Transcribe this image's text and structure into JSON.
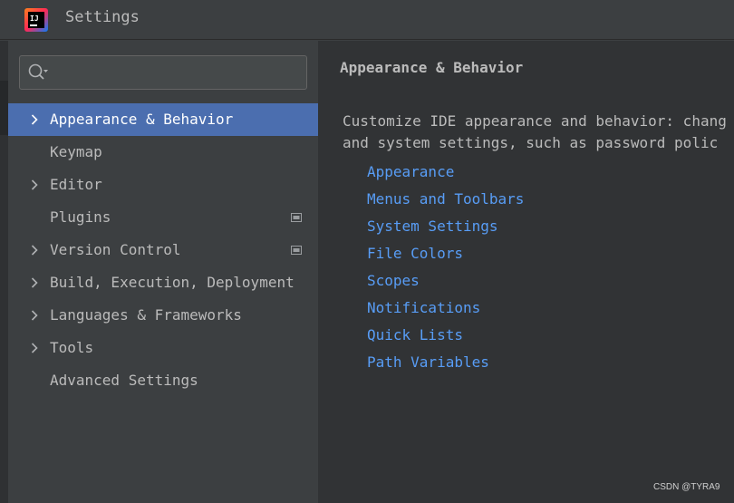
{
  "window": {
    "title": "Settings",
    "logo_text": "IJ"
  },
  "search": {
    "placeholder": "",
    "value": ""
  },
  "sidebar": {
    "items": [
      {
        "label": "Appearance & Behavior",
        "expandable": true,
        "selected": true,
        "badge": false
      },
      {
        "label": "Keymap",
        "expandable": false,
        "selected": false,
        "badge": false
      },
      {
        "label": "Editor",
        "expandable": true,
        "selected": false,
        "badge": false
      },
      {
        "label": "Plugins",
        "expandable": false,
        "selected": false,
        "badge": true
      },
      {
        "label": "Version Control",
        "expandable": true,
        "selected": false,
        "badge": true
      },
      {
        "label": "Build, Execution, Deployment",
        "expandable": true,
        "selected": false,
        "badge": false
      },
      {
        "label": "Languages & Frameworks",
        "expandable": true,
        "selected": false,
        "badge": false
      },
      {
        "label": "Tools",
        "expandable": true,
        "selected": false,
        "badge": false
      },
      {
        "label": "Advanced Settings",
        "expandable": false,
        "selected": false,
        "badge": false
      }
    ]
  },
  "content": {
    "title": "Appearance & Behavior",
    "description_line1": "Customize IDE appearance and behavior: chang",
    "description_line2": "and system settings, such as password polic",
    "links": [
      "Appearance",
      "Menus and Toolbars",
      "System Settings",
      "File Colors",
      "Scopes",
      "Notifications",
      "Quick Lists",
      "Path Variables"
    ]
  },
  "watermark": "CSDN @TYRA9",
  "colors": {
    "background": "#3c3f41",
    "content_background": "#313335",
    "selection": "#4b6eaf",
    "link": "#589df6",
    "text": "#bbbbbb"
  },
  "icons": {
    "logo": "intellij-logo-icon",
    "search": "search-icon",
    "chevron": "chevron-right-icon",
    "badge": "project-level-settings-icon"
  }
}
